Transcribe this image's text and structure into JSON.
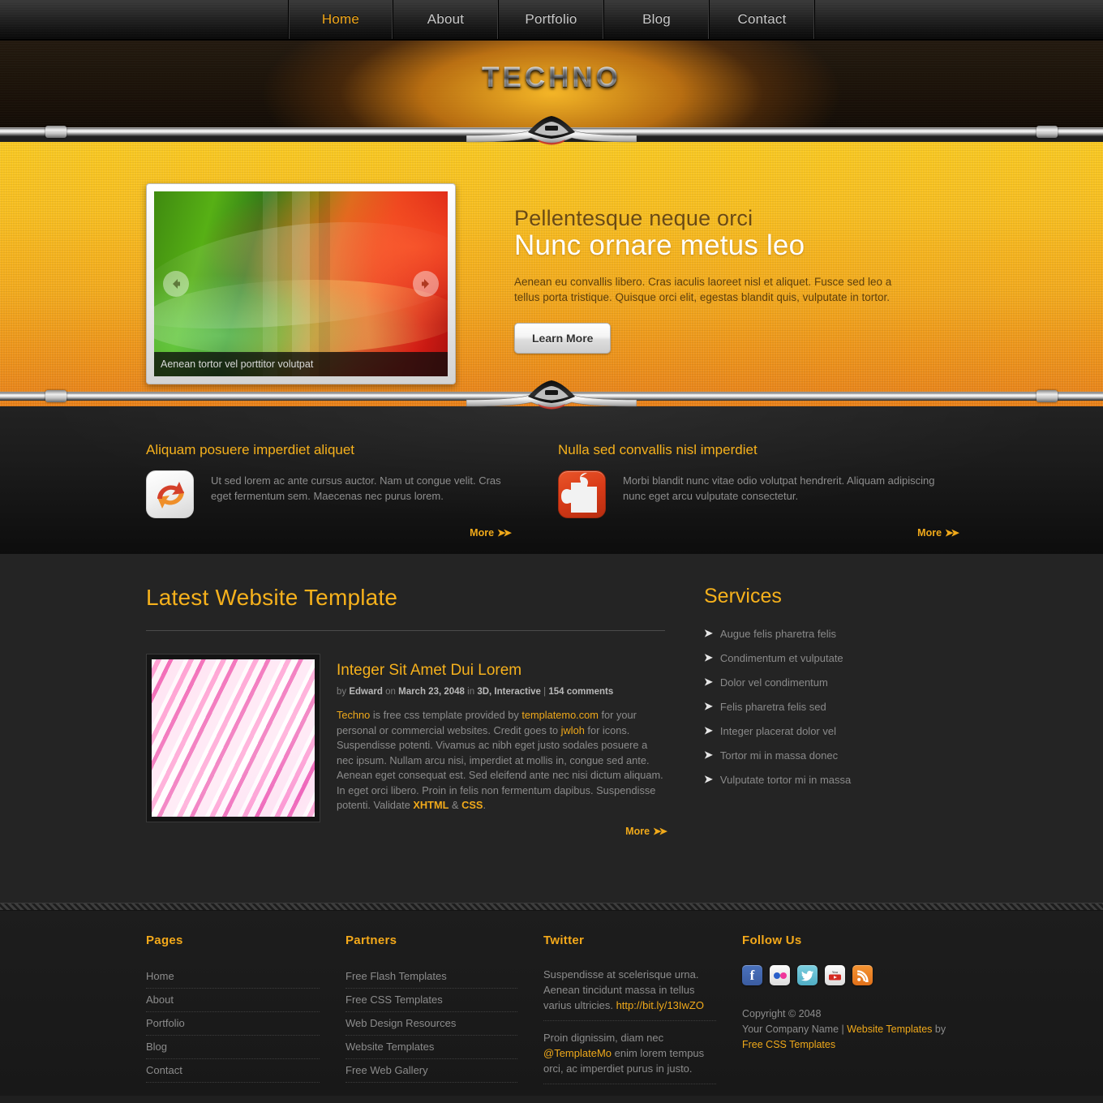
{
  "nav": {
    "items": [
      {
        "label": "Home",
        "active": true
      },
      {
        "label": "About",
        "active": false
      },
      {
        "label": "Portfolio",
        "active": false
      },
      {
        "label": "Blog",
        "active": false
      },
      {
        "label": "Contact",
        "active": false
      }
    ]
  },
  "header": {
    "logo": "TECHNO"
  },
  "banner": {
    "slider": {
      "caption": "Aenean tortor vel porttitor volutpat",
      "prev_icon": "arrow-left-icon",
      "next_icon": "arrow-right-icon"
    },
    "subtitle": "Pellentesque neque orci",
    "title": "Nunc ornare metus leo",
    "paragraph": "Aenean eu convallis libero. Cras iaculis laoreet nisl et aliquet. Fusce sed leo a tellus porta tristique. Quisque orci elit, egestas blandit quis, vulputate in tortor.",
    "button": "Learn More"
  },
  "features": [
    {
      "title": "Aliquam posuere imperdiet aliquet",
      "icon": "refresh-arrows-icon",
      "text": "Ut sed lorem ac ante cursus auctor. Nam ut congue velit. Cras eget fermentum sem. Maecenas nec purus lorem.",
      "more": "More"
    },
    {
      "title": "Nulla sed convallis nisl imperdiet",
      "icon": "puzzle-piece-icon",
      "text": "Morbi blandit nunc vitae odio volutpat hendrerit. Aliquam adipiscing nunc eget arcu vulputate consectetur.",
      "more": "More"
    }
  ],
  "main": {
    "heading": "Latest Website Template",
    "post": {
      "title": "Integer Sit Amet Dui Lorem",
      "meta": {
        "by_label": "by",
        "author": "Edward",
        "on_label": "on",
        "date": "March 23, 2048",
        "in_label": "in",
        "categories": "3D, Interactive",
        "separator": "|",
        "comments": "154 comments"
      },
      "body_1": "Techno",
      "body_2": " is free css template provided by ",
      "body_3": "templatemo.com",
      "body_4": " for your personal or commercial websites. Credit goes to ",
      "body_5": "jwloh",
      "body_6": " for icons. Suspendisse potenti. Vivamus ac nibh eget justo sodales posuere a nec ipsum. Nullam arcu nisi, imperdiet at mollis in, congue sed ante. Aenean eget consequat est. Sed eleifend ante nec nisi dictum aliquam. In eget orci libero. Proin in felis non fermentum dapibus. Suspendisse potenti. Validate ",
      "body_7": "XHTML",
      "body_8": " & ",
      "body_9": "CSS",
      "body_10": ".",
      "more": "More"
    }
  },
  "services": {
    "heading": "Services",
    "items": [
      "Augue felis pharetra felis",
      "Condimentum et vulputate",
      "Dolor vel condimentum",
      "Felis pharetra felis sed",
      "Integer placerat dolor vel",
      "Tortor mi in massa donec",
      "Vulputate tortor mi in massa"
    ]
  },
  "footer": {
    "pages": {
      "heading": "Pages",
      "items": [
        "Home",
        "About",
        "Portfolio",
        "Blog",
        "Contact"
      ]
    },
    "partners": {
      "heading": "Partners",
      "items": [
        "Free Flash Templates",
        "Free CSS Templates",
        "Web Design Resources",
        "Website Templates",
        "Free Web Gallery"
      ]
    },
    "twitter": {
      "heading": "Twitter",
      "tweet1_text": "Suspendisse at scelerisque urna. Aenean tincidunt massa in tellus varius ultricies. ",
      "tweet1_link": "http://bit.ly/13IwZO",
      "tweet2_pre": "Proin dignissim, diam nec ",
      "tweet2_handle": "@TemplateMo",
      "tweet2_post": " enim lorem tempus orci, ac imperdiet purus in justo."
    },
    "follow": {
      "heading": "Follow Us",
      "icons": [
        "facebook-icon",
        "flickr-icon",
        "twitter-icon",
        "youtube-icon",
        "rss-icon"
      ],
      "copyright_1": "Copyright © 2048",
      "copyright_2": "Your Company Name",
      "copyright_sep": " | ",
      "copyright_link_1": "Website Templates",
      "copyright_by": " by ",
      "copyright_link_2": "Free CSS Templates"
    }
  },
  "colors": {
    "accent": "#f2a81b",
    "banner_top": "#f9c923",
    "banner_bottom": "#e8811a",
    "dark_bg": "#242424"
  }
}
